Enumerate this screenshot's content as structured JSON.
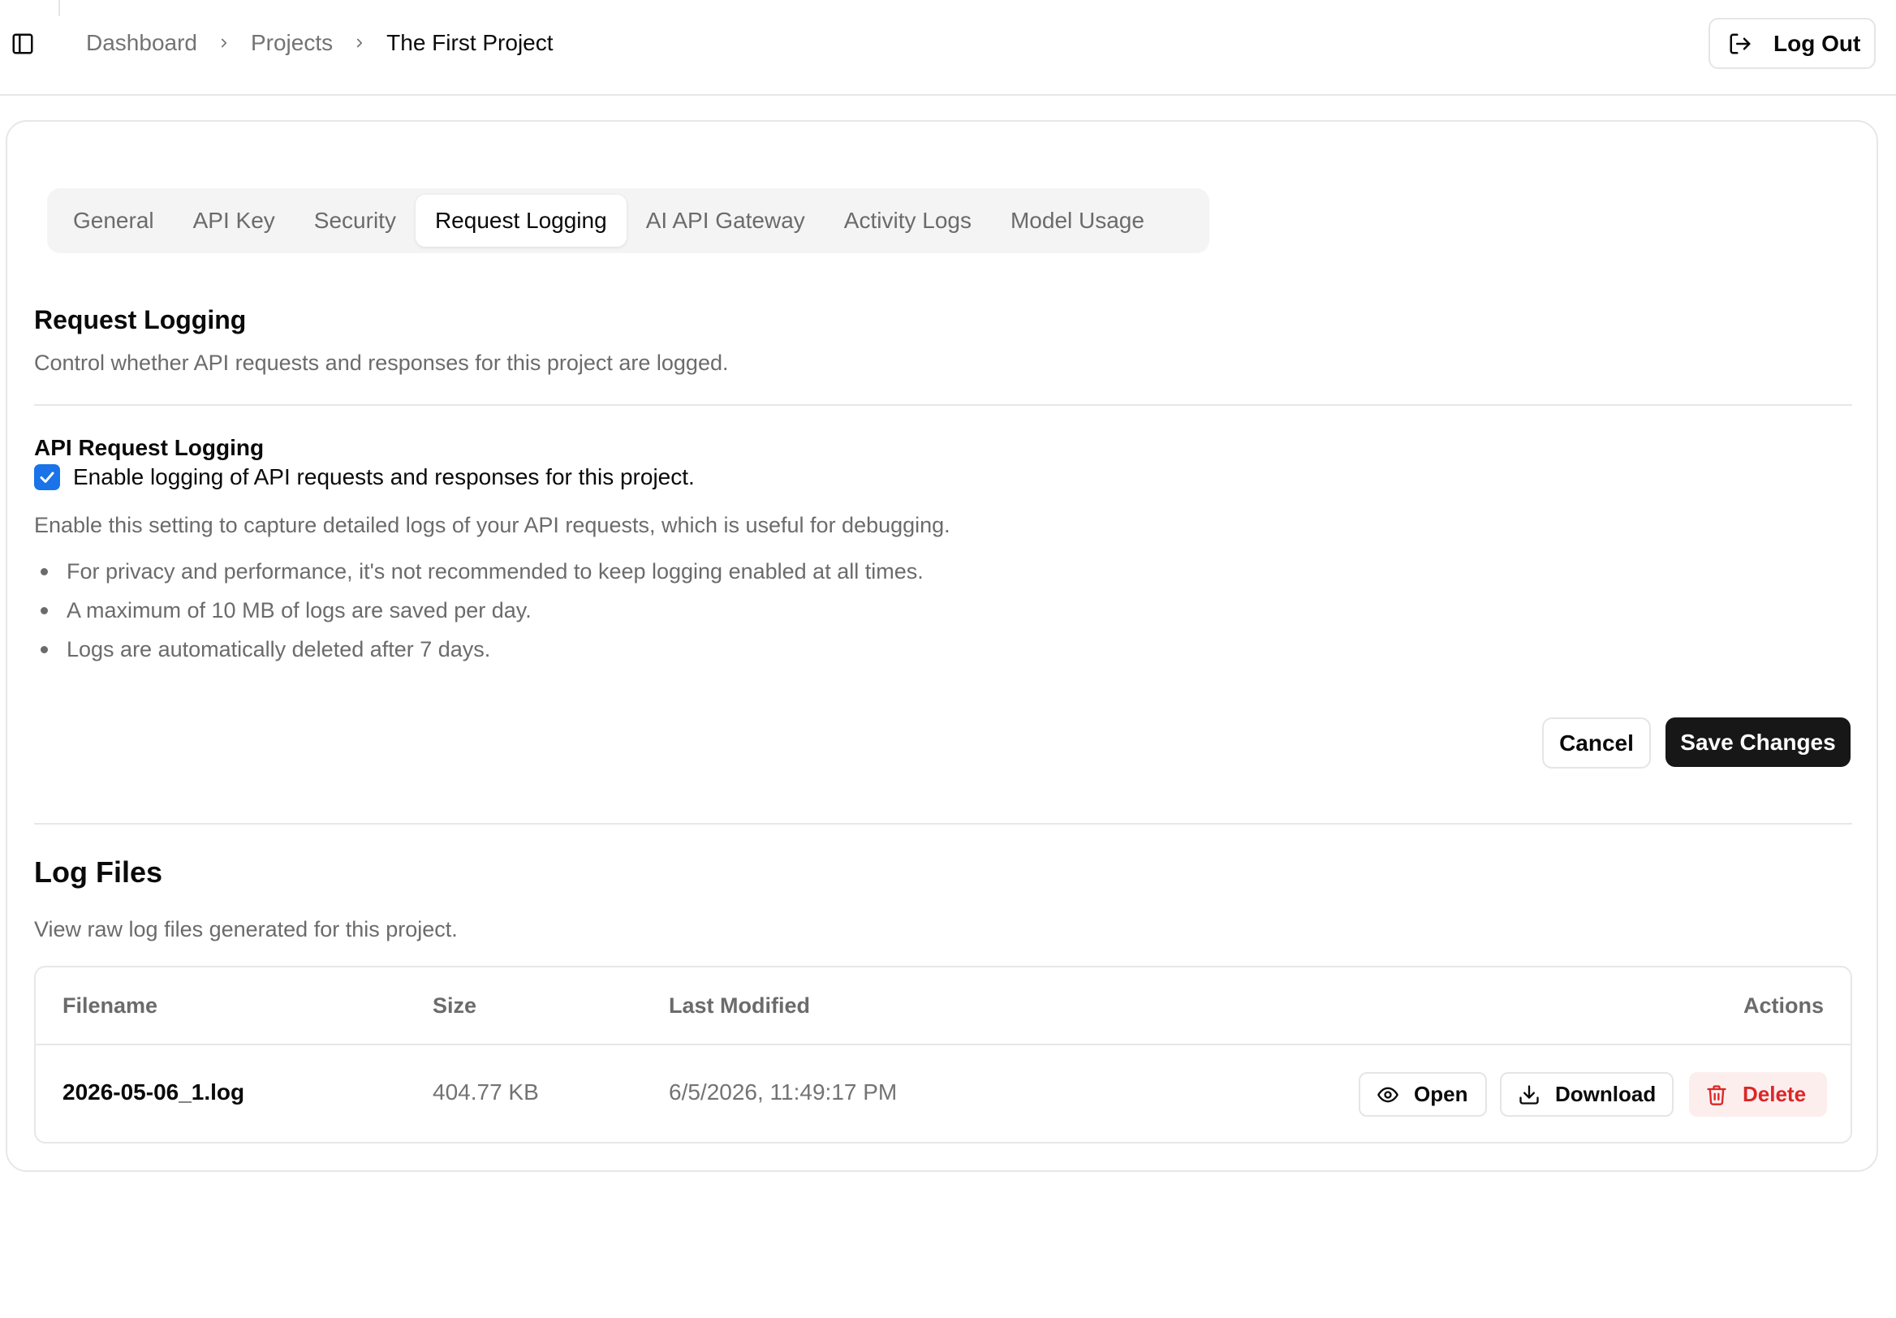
{
  "breadcrumb": {
    "items": [
      "Dashboard",
      "Projects"
    ],
    "current": "The First Project"
  },
  "header": {
    "logout_label": "Log Out",
    "icons": {
      "sidebar_toggle": "panel-left-icon",
      "logout": "log-out-icon",
      "separator": "chevron-right-icon"
    }
  },
  "tabs": [
    {
      "label": "General",
      "active": false
    },
    {
      "label": "API Key",
      "active": false
    },
    {
      "label": "Security",
      "active": false
    },
    {
      "label": "Request Logging",
      "active": true
    },
    {
      "label": "AI API Gateway",
      "active": false
    },
    {
      "label": "Activity Logs",
      "active": false
    },
    {
      "label": "Model Usage",
      "active": false
    }
  ],
  "request_logging": {
    "title": "Request Logging",
    "description": "Control whether API requests and responses for this project are logged.",
    "field_label": "API Request Logging",
    "checkbox_label": "Enable logging of API requests and responses for this project.",
    "checkbox_checked": true,
    "help_text": "Enable this setting to capture detailed logs of your API requests, which is useful for debugging.",
    "bullets": [
      "For privacy and performance, it's not recommended to keep logging enabled at all times.",
      "A maximum of 10 MB of logs are saved per day.",
      "Logs are automatically deleted after 7 days."
    ],
    "cancel_label": "Cancel",
    "save_label": "Save Changes"
  },
  "log_files": {
    "title": "Log Files",
    "description": "View raw log files generated for this project.",
    "columns": {
      "filename": "Filename",
      "size": "Size",
      "last_modified": "Last Modified",
      "actions": "Actions"
    },
    "rows": [
      {
        "filename": "2026-05-06_1.log",
        "size": "404.77 KB",
        "last_modified": "6/5/2026, 11:49:17 PM"
      }
    ],
    "actions": {
      "open_label": "Open",
      "download_label": "Download",
      "delete_label": "Delete"
    }
  },
  "colors": {
    "accent_checkbox": "#1a73e8",
    "primary_button": "#171717",
    "danger_text": "#dc2626",
    "danger_bg": "#fdeeee"
  }
}
